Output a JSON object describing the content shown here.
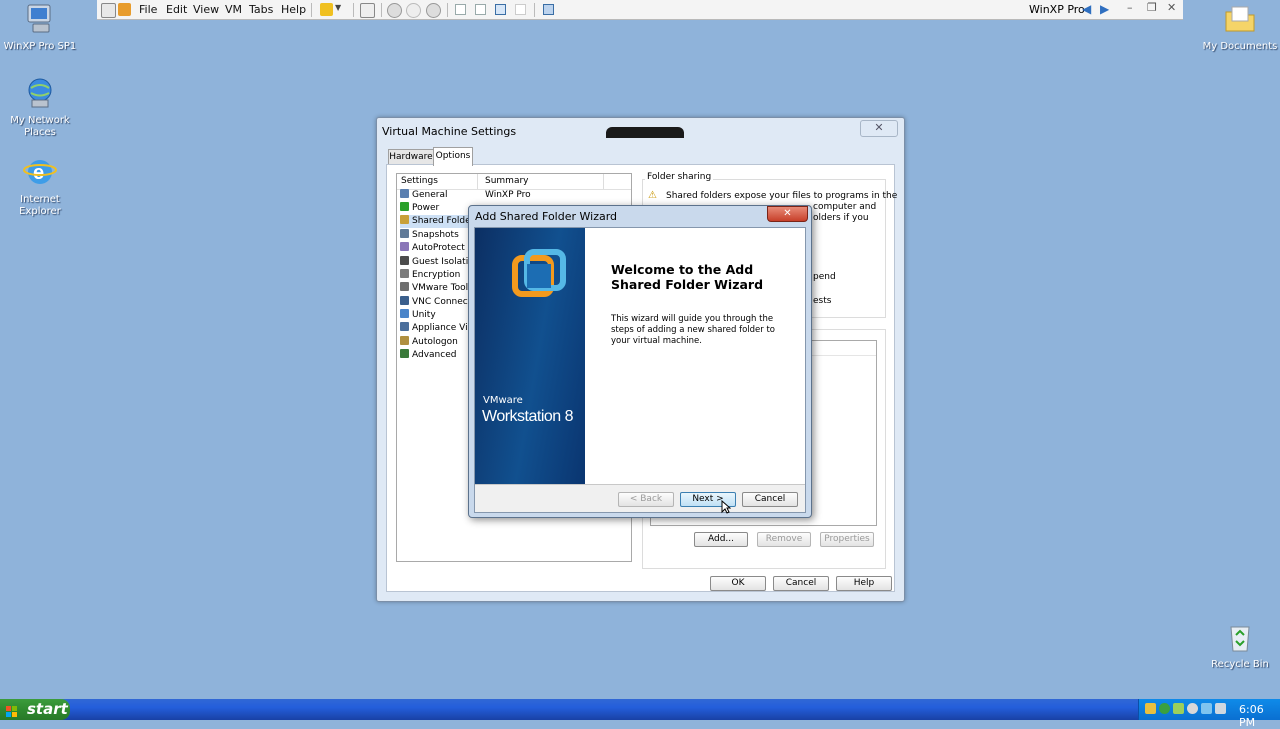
{
  "host_toolbar": {
    "menus": [
      "File",
      "Edit",
      "View",
      "VM",
      "Tabs",
      "Help"
    ],
    "vm_name": "WinXP Pro"
  },
  "desktop": {
    "icons_left": [
      {
        "label": "WinXP Pro SP1",
        "icon": "computer-icon"
      },
      {
        "label": "My Network Places",
        "icon": "network-places-icon"
      },
      {
        "label": "Internet Explorer",
        "icon": "internet-explorer-icon"
      }
    ],
    "icons_right": [
      {
        "label": "My Documents",
        "icon": "folder-icon"
      },
      {
        "label": "Recycle Bin",
        "icon": "recycle-bin-icon"
      }
    ]
  },
  "vm_settings": {
    "title": "Virtual Machine Settings",
    "tabs": [
      "Hardware",
      "Options"
    ],
    "active_tab": "Options",
    "table_headers": {
      "settings": "Settings",
      "summary": "Summary"
    },
    "rows": [
      {
        "label": "General",
        "summary": "WinXP Pro",
        "color": "#5a7fb0"
      },
      {
        "label": "Power",
        "summary": "",
        "color": "#2aa02a"
      },
      {
        "label": "Shared Folders",
        "summary": "",
        "color": "#c8a038"
      },
      {
        "label": "Snapshots",
        "summary": "",
        "color": "#607a98"
      },
      {
        "label": "AutoProtect",
        "summary": "",
        "color": "#8a76b8"
      },
      {
        "label": "Guest Isolation",
        "summary": "",
        "color": "#4c4c4c"
      },
      {
        "label": "Encryption",
        "summary": "",
        "color": "#7b7b7b"
      },
      {
        "label": "VMware Tools",
        "summary": "",
        "color": "#6f6f6f"
      },
      {
        "label": "VNC Connections",
        "summary": "",
        "color": "#3b5f8c"
      },
      {
        "label": "Unity",
        "summary": "",
        "color": "#4a84c9"
      },
      {
        "label": "Appliance View",
        "summary": "",
        "color": "#4b6f9c"
      },
      {
        "label": "Autologon",
        "summary": "",
        "color": "#b09040"
      },
      {
        "label": "Advanced",
        "summary": "",
        "color": "#3a7a3a"
      }
    ],
    "folder_sharing": {
      "title": "Folder sharing",
      "text_line1": "Shared folders expose your files to programs in the",
      "text_partial": [
        "computer and",
        "olders if you"
      ],
      "partial_end": [
        "pend",
        "ests"
      ]
    },
    "folder_buttons": {
      "add": "Add...",
      "remove": "Remove",
      "properties": "Properties"
    },
    "footer_buttons": {
      "ok": "OK",
      "cancel": "Cancel",
      "help": "Help"
    }
  },
  "wizard": {
    "title": "Add Shared Folder Wizard",
    "brand": "VMware",
    "product": "Workstation 8",
    "heading": "Welcome to the Add Shared Folder Wizard",
    "description": "This wizard will guide you through the steps of adding a new shared folder to your virtual machine.",
    "buttons": {
      "back": "< Back",
      "next": "Next >",
      "cancel": "Cancel"
    }
  },
  "taskbar": {
    "start_label": "start",
    "clock": "6:06 PM"
  },
  "colors": {
    "desktop": "#8fb3da",
    "taskbar": "#245edb",
    "start": "#2f8a2f",
    "wizard_banner": "#0e3e78"
  }
}
